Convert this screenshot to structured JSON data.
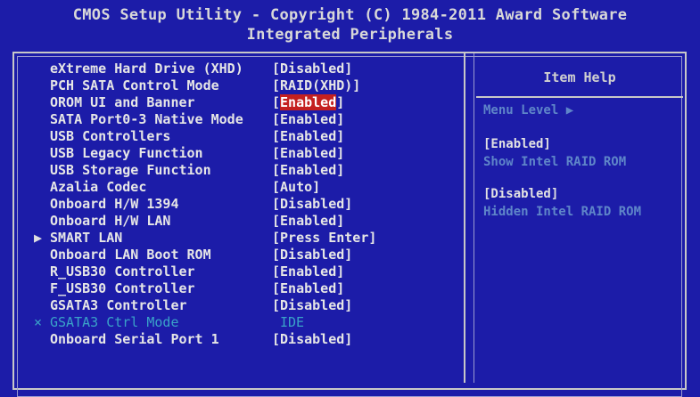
{
  "header": {
    "title": "CMOS Setup Utility - Copyright (C) 1984-2011 Award Software",
    "subtitle": "Integrated Peripherals"
  },
  "menu": {
    "items": [
      {
        "label": "eXtreme Hard Drive (XHD)",
        "value": "[Disabled]",
        "arrow": ""
      },
      {
        "label": "PCH SATA Control Mode",
        "value": "[RAID(XHD)]",
        "arrow": ""
      },
      {
        "label": "OROM UI and Banner",
        "value": "[Enabled]",
        "arrow": "",
        "selected": true
      },
      {
        "label": "SATA Port0-3 Native Mode",
        "value": "[Enabled]",
        "arrow": ""
      },
      {
        "label": "USB Controllers",
        "value": "[Enabled]",
        "arrow": ""
      },
      {
        "label": "USB Legacy Function",
        "value": "[Enabled]",
        "arrow": ""
      },
      {
        "label": "USB Storage Function",
        "value": "[Enabled]",
        "arrow": ""
      },
      {
        "label": "Azalia Codec",
        "value": "[Auto]",
        "arrow": ""
      },
      {
        "label": "Onboard H/W 1394",
        "value": "[Disabled]",
        "arrow": ""
      },
      {
        "label": "Onboard H/W LAN",
        "value": "[Enabled]",
        "arrow": ""
      },
      {
        "label": "SMART LAN",
        "value": "[Press Enter]",
        "arrow": "▶"
      },
      {
        "label": "Onboard LAN Boot ROM",
        "value": "[Disabled]",
        "arrow": ""
      },
      {
        "label": "R_USB30 Controller",
        "value": "[Enabled]",
        "arrow": ""
      },
      {
        "label": "F_USB30 Controller",
        "value": "[Enabled]",
        "arrow": ""
      },
      {
        "label": "GSATA3 Controller",
        "value": "[Disabled]",
        "arrow": ""
      },
      {
        "label": "GSATA3 Ctrl Mode",
        "value": "IDE",
        "arrow": "×",
        "disabled": true
      },
      {
        "label": "Onboard Serial Port 1",
        "value": "[Disabled]",
        "arrow": ""
      }
    ]
  },
  "help": {
    "title": "Item Help",
    "menu_level": "Menu Level  ▶",
    "opt1_value": "[Enabled]",
    "opt1_desc": "Show Intel RAID ROM",
    "opt2_value": "[Disabled]",
    "opt2_desc": "Hidden Intel RAID ROM"
  },
  "colors": {
    "background": "#1c1ca8",
    "highlight": "#c42020",
    "disabled_text": "#3aa3c8"
  }
}
